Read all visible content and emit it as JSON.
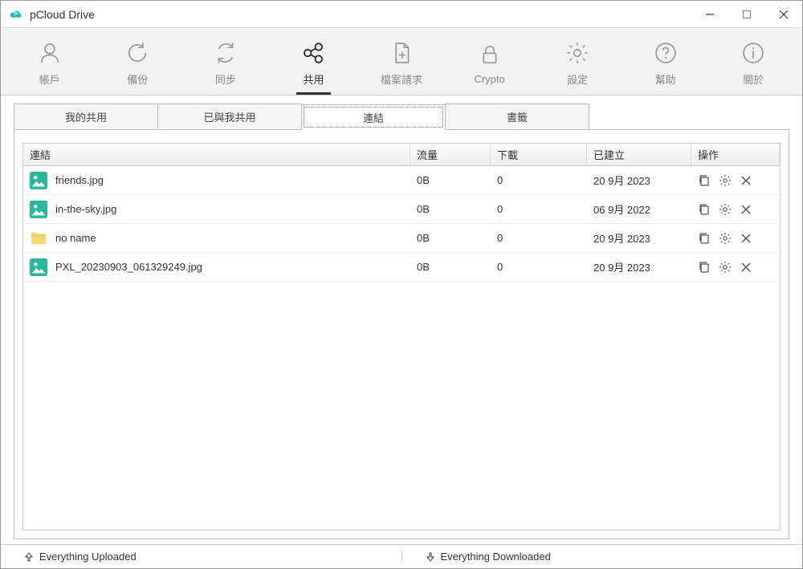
{
  "window": {
    "title": "pCloud Drive"
  },
  "toolbar": {
    "items": [
      {
        "label": "帳戶"
      },
      {
        "label": "備份"
      },
      {
        "label": "同步"
      },
      {
        "label": "共用"
      },
      {
        "label": "檔案請求"
      },
      {
        "label": "Crypto"
      },
      {
        "label": "設定"
      },
      {
        "label": "幫助"
      },
      {
        "label": "關於"
      }
    ],
    "active_index": 3
  },
  "subtabs": {
    "items": [
      {
        "label": "我的共用"
      },
      {
        "label": "已與我共用"
      },
      {
        "label": "連結"
      },
      {
        "label": "書籤"
      }
    ],
    "active_index": 2
  },
  "grid": {
    "columns": {
      "name": "連結",
      "traffic": "流量",
      "downloads": "下載",
      "created": "已建立",
      "actions": "操作"
    },
    "rows": [
      {
        "type": "image",
        "name": "friends.jpg",
        "traffic": "0B",
        "downloads": "0",
        "created": "20 9月 2023"
      },
      {
        "type": "image",
        "name": "in-the-sky.jpg",
        "traffic": "0B",
        "downloads": "0",
        "created": "06 9月 2022"
      },
      {
        "type": "folder",
        "name": "no name",
        "traffic": "0B",
        "downloads": "0",
        "created": "20 9月 2023"
      },
      {
        "type": "image",
        "name": "PXL_20230903_061329249.jpg",
        "traffic": "0B",
        "downloads": "0",
        "created": "20 9月 2023"
      }
    ]
  },
  "status": {
    "uploaded": "Everything Uploaded",
    "downloaded": "Everything Downloaded"
  }
}
